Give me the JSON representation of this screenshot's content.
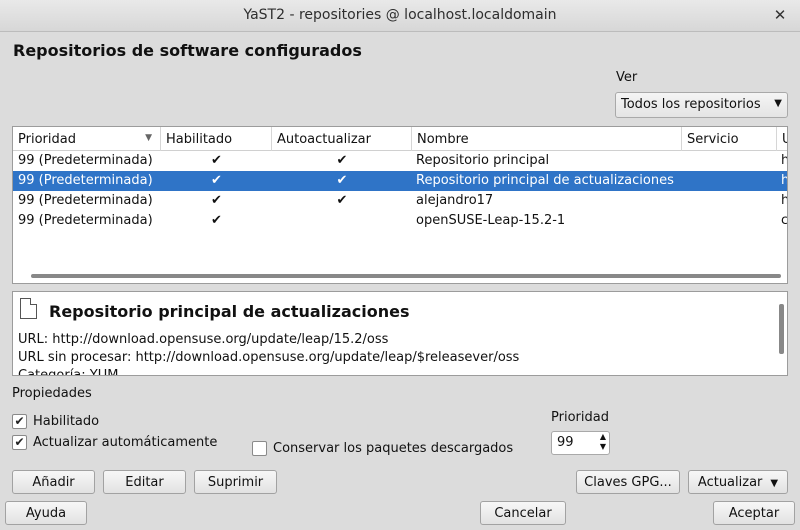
{
  "window": {
    "title": "YaST2 - repositories @ localhost.localdomain",
    "close_icon": "close-icon"
  },
  "heading": "Repositorios de software configurados",
  "view": {
    "label": "Ver",
    "selected": "Todos los repositorios"
  },
  "table": {
    "columns": [
      "Prioridad",
      "Habilitado",
      "Autoactualizar",
      "Nombre",
      "Servicio",
      "U"
    ],
    "rows": [
      {
        "priority": "99 (Predeterminada)",
        "enabled": "✔",
        "autorefresh": "✔",
        "name": "Repositorio principal",
        "service": "",
        "url": "h",
        "selected": false
      },
      {
        "priority": "99 (Predeterminada)",
        "enabled": "✔",
        "autorefresh": "✔",
        "name": "Repositorio principal de actualizaciones",
        "service": "",
        "url": "h",
        "selected": true
      },
      {
        "priority": "99 (Predeterminada)",
        "enabled": "✔",
        "autorefresh": "✔",
        "name": "alejandro17",
        "service": "",
        "url": "h",
        "selected": false
      },
      {
        "priority": "99 (Predeterminada)",
        "enabled": "✔",
        "autorefresh": "",
        "name": "openSUSE-Leap-15.2-1",
        "service": "",
        "url": "c",
        "selected": false
      }
    ]
  },
  "details": {
    "title": "Repositorio principal de actualizaciones",
    "url": "URL: http://download.opensuse.org/update/leap/15.2/oss",
    "raw_url": "URL sin procesar: http://download.opensuse.org/update/leap/$releasever/oss",
    "category": "Categoría: YUM"
  },
  "properties": {
    "label": "Propiedades",
    "enabled": {
      "label": "Habilitado",
      "checked": true
    },
    "autorefresh": {
      "label": "Actualizar automáticamente",
      "checked": true
    },
    "keep_packages": {
      "label": "Conservar los paquetes descargados",
      "checked": false
    },
    "priority_label": "Prioridad",
    "priority_value": "99"
  },
  "buttons": {
    "add": "Añadir",
    "edit": "Editar",
    "delete": "Suprimir",
    "gpg": "Claves GPG...",
    "refresh": "Actualizar",
    "help": "Ayuda",
    "cancel": "Cancelar",
    "accept": "Aceptar"
  },
  "colors": {
    "selection": "#2f74c7"
  }
}
